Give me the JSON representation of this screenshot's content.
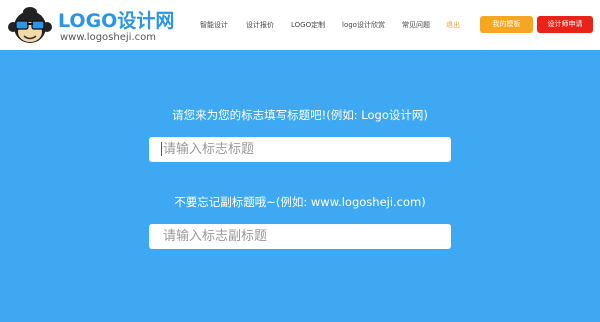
{
  "logo": {
    "title": "LOGO设计网",
    "url": "www.logosheji.com",
    "mascot_icon": "monkey-with-sunglasses-icon"
  },
  "nav": {
    "items": [
      {
        "label": "智能设计"
      },
      {
        "label": "设计报价"
      },
      {
        "label": "LOGO定制"
      },
      {
        "label": "logo设计欣赏"
      },
      {
        "label": "常见问题"
      },
      {
        "label": "退出",
        "active": true
      }
    ],
    "my_designs_button": "我的模板",
    "designer_apply_button": "设计师申请"
  },
  "form": {
    "title_prompt": "请您来为您的标志填写标题吧!(例如: Logo设计网)",
    "title_placeholder": "请输入标志标题",
    "subtitle_prompt": "不要忘记副标题哦~(例如: www.logosheji.com)",
    "subtitle_placeholder": "请输入标志副标题"
  },
  "colors": {
    "background": "#3ea9f2",
    "brand_blue": "#2d95e6",
    "active_nav": "#f0a030",
    "orange_button": "#f5a623",
    "red_button": "#e8241a"
  }
}
